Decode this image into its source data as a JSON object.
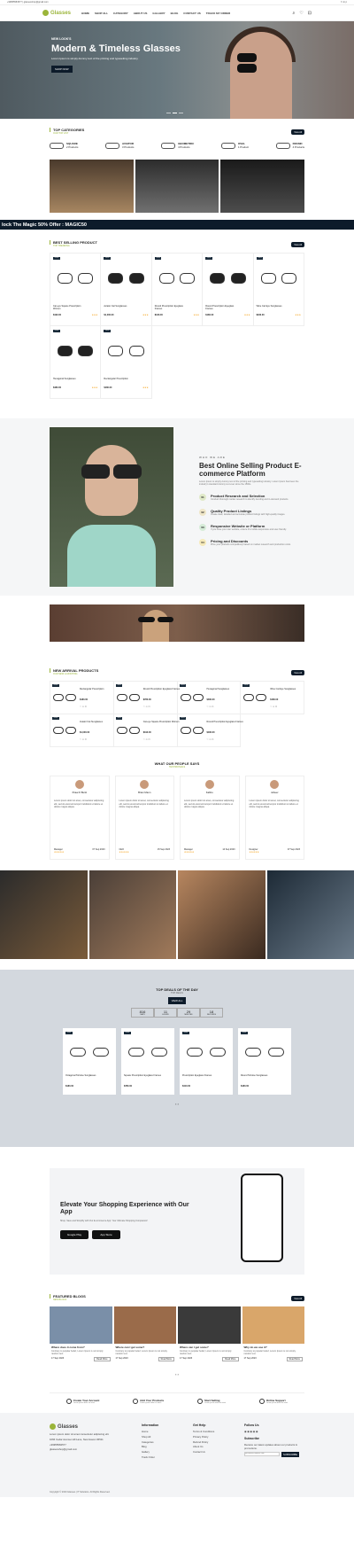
{
  "topbar": {
    "left": "+99955584577  |  glassesshop@gmail.com",
    "right": "f t in p"
  },
  "nav": {
    "logo": "Glasses",
    "items": [
      "HOME",
      "SHOP ALL",
      "CATEGORY",
      "ABOUT US",
      "GALLERY",
      "BLOG",
      "CONTACT US",
      "TRACK MY ORDER"
    ]
  },
  "hero": {
    "tag": "NEW LOOK'S",
    "title": "Modern & Timeless Glasses",
    "sub": "Lorem Ipsum is simply dummy text of the printing and typesetting industry.",
    "btn": "SHOP NOW"
  },
  "categories": {
    "title": "TOP CATEGORIES",
    "sub": "OUR TOP LIST",
    "view": "View All",
    "items": [
      {
        "name": "SQUARE",
        "count": "2 Products"
      },
      {
        "name": "AVIATOR",
        "count": "3 Products"
      },
      {
        "name": "GEOMETRIC",
        "count": "4 Products"
      },
      {
        "name": "OVAL",
        "count": "1 Product"
      },
      {
        "name": "ROUND",
        "count": "4 Products"
      }
    ]
  },
  "marquee": "lock The Magic 50% Offer : MAGIC50",
  "bestselling": {
    "title": "BEST SELLING PRODUCT",
    "sub": "TOP TRENDING",
    "view": "View All",
    "items": [
      {
        "badge": "-20%",
        "name": "Cat-eye Square Prescription Women",
        "price": "$190.00",
        "stars": "★★★"
      },
      {
        "badge": "-20%",
        "name": "Aviator Cat Sunglasses",
        "price": "$1,000.00",
        "stars": "★★★"
      },
      {
        "badge": "-20%",
        "name": "Round Prescription Eyeglass Frames",
        "price": "$180.00",
        "stars": "★★★"
      },
      {
        "badge": "-20%",
        "name": "Round Prescription Eyeglass Frames",
        "price": "$180.00",
        "stars": "★★★"
      },
      {
        "badge": "-20%",
        "name": "Wine Cat Eye Sunglasses",
        "price": "$180.00",
        "stars": "★★★"
      },
      {
        "badge": "-20%",
        "name": "Hexagonal Sunglasses",
        "price": "$480.00",
        "stars": "★★★"
      },
      {
        "badge": "-20%",
        "name": "Rectangular Prescription",
        "price": "$180.00",
        "stars": "★★★"
      }
    ]
  },
  "about": {
    "tag": "WHO WE ARE",
    "title": "Best Online Selling Product E-commerce Platform",
    "desc": "Lorem Ipsum is simply dummy text of the printing and typesetting industry. Lorem Ipsum has been the industry's standard dummy text ever since the 1500s.",
    "steps": [
      {
        "n": "01",
        "t": "Product Research and Selection",
        "d": "Conduct thorough market research to identify trending and in-demand products.",
        "c": "#dfe9c8"
      },
      {
        "n": "02",
        "t": "Quality Product Listings",
        "d": "Create clear, detailed and accurate product listings with high-quality images.",
        "c": "#efe6c7"
      },
      {
        "n": "03",
        "t": "Responsive Website or Platform",
        "d": "If you have your own website, ensure it's mobile-responsive and user-friendly.",
        "c": "#d6ecd8"
      },
      {
        "n": "04",
        "t": "Pricing and Discounts",
        "d": "Price your products competitively based on market research and production costs.",
        "c": "#f6eab9"
      }
    ]
  },
  "newarrival": {
    "title": "NEW ARRIVAL PRODUCTS",
    "sub": "OUR NEW LAUNCHING",
    "view": "View All",
    "items": [
      {
        "badge": "-20%",
        "name": "Rectangular Prescription",
        "price": "$180.00"
      },
      {
        "badge": "-20%",
        "name": "Round Prescription Eyeglass Frames",
        "price": "$780.00"
      },
      {
        "badge": "-20%",
        "name": "Hexagonal Sunglasses",
        "price": "$480.00"
      },
      {
        "badge": "-20%",
        "name": "Wine Cat Eye Sunglasses",
        "price": "$180.00"
      },
      {
        "badge": "-20%",
        "name": "Aviator Cat Sunglasses",
        "price": "$1,000.00"
      },
      {
        "badge": "-20%",
        "name": "Cat-eye Square Prescription Women",
        "price": "$190.00"
      },
      {
        "badge": "-20%",
        "name": "Round Prescription Eyeglass Frames",
        "price": "$180.00"
      }
    ]
  },
  "testimonials": {
    "title": "WHAT OUR PEOPLE SAYS",
    "sub": "TESTIMONIALS",
    "items": [
      {
        "name": "Xhaa Fl Burki",
        "text": "Lorem ipsum dolor sit amet, consectetur adipiscing elit, sed do eiusmod tempor incididunt ut labore et dolore magna aliqua.",
        "role": "Manager",
        "date": "07 Sep 2023"
      },
      {
        "name": "Brian Mann",
        "text": "Lorem ipsum dolor sit amet, consectetur adipiscing elit, sed do eiusmod tempor incididunt ut labore et dolore magna aliqua.",
        "role": "CEO",
        "date": "15 Sep 2023"
      },
      {
        "name": "Kabbu",
        "text": "Lorem ipsum dolor sit amet, consectetur adipiscing elit, sed do eiusmod tempor incididunt ut labore et dolore magna aliqua.",
        "role": "Manager",
        "date": "14 Sep 2023"
      },
      {
        "name": "Jaheer",
        "text": "Lorem ipsum dolor sit amet, consectetur adipiscing elit, sed do eiusmod tempor incididunt ut labore et dolore magna aliqua.",
        "role": "Designer",
        "date": "07 Sep 2023"
      }
    ]
  },
  "deals": {
    "title": "TOP DEALS OF THE DAY",
    "sub": "TOP DEALS",
    "btn": "VIEW ALL",
    "countdown": [
      {
        "v": "816",
        "l": "DAYS"
      },
      {
        "v": "11",
        "l": "HOURS"
      },
      {
        "v": "29",
        "l": "MINUTES"
      },
      {
        "v": "18",
        "l": "SECONDS"
      }
    ],
    "items": [
      {
        "badge": "-20%",
        "name": "Octagonal Tortoise Sunglasses",
        "price": "$180.00"
      },
      {
        "badge": "-20%",
        "name": "Square Prescription Eyeglass Frames",
        "price": "$780.00"
      },
      {
        "badge": "-20%",
        "name": "Prescription Eyeglass Frames",
        "price": "$410.00"
      },
      {
        "badge": "-20%",
        "name": "Round Tortoise Sunglasses",
        "price": "$180.00"
      }
    ]
  },
  "app": {
    "title": "Elevate Your Shopping Experience with Our App",
    "sub": "Shop, Save and Simplify with Our E-commerce App: Your Ultimate Shopping Companion!",
    "google": "Google Play",
    "apple": "App Store"
  },
  "blogs": {
    "title": "FEATURED BLOGS",
    "sub": "NEW BLOGS",
    "view": "View All",
    "items": [
      {
        "t": "Where does it come from?",
        "d": "Contrary to popular belief, Lorem Ipsum is not simply random text.",
        "date": "17 Sep 2023",
        "more": "Read More"
      },
      {
        "t": "Where can I get some?",
        "d": "Contrary to popular belief, Lorem Ipsum is not simply random text.",
        "date": "17 Sep 2023",
        "more": "Read More"
      },
      {
        "t": "Where can I get some?",
        "d": "Contrary to popular belief, Lorem Ipsum is not simply random text.",
        "date": "17 Sep 2023",
        "more": "Read More"
      },
      {
        "t": "Why do we use it?",
        "d": "Contrary to popular belief, Lorem Ipsum is not simply random text.",
        "date": "17 Sep 2023",
        "more": "Read More"
      }
    ]
  },
  "features": [
    {
      "t": "Create Your Account",
      "d": "Lorem ipsum dolor sit amet"
    },
    {
      "t": "Add Your Products",
      "d": "Lorem ipsum dolor sit amet"
    },
    {
      "t": "Start Selling",
      "d": "Lorem ipsum dolor sit amet"
    },
    {
      "t": "Online Support",
      "d": "Lorem ipsum dolor sit amet"
    }
  ],
  "footer": {
    "logo": "Glasses",
    "desc": "Lorem ipsum dolor sit amet consectetur adipiscing elit.",
    "address": "1066 Cedar Avenue Hill Lane, New Haven 06511",
    "phone": "+99955584577",
    "email": "glassesshop@gmail.com",
    "info_title": "Information",
    "info": [
      "Home",
      "Shop All",
      "Categories",
      "Blog",
      "Gallery",
      "Track Order"
    ],
    "help_title": "Get Help",
    "help": [
      "Terms & Conditions",
      "Privacy Policy",
      "Refund Policy",
      "About Us",
      "Contact Us"
    ],
    "follow": "Follow Us",
    "subscribe": "Subscribe",
    "sub_desc": "Receive our latest updates about our products & promotions.",
    "placeholder": "youremail@domain.com",
    "sub_btn": "SUBSCRIBE",
    "copy": "Copyright © 2023 Glasses | IT Solutions. All Rights Reserved."
  }
}
